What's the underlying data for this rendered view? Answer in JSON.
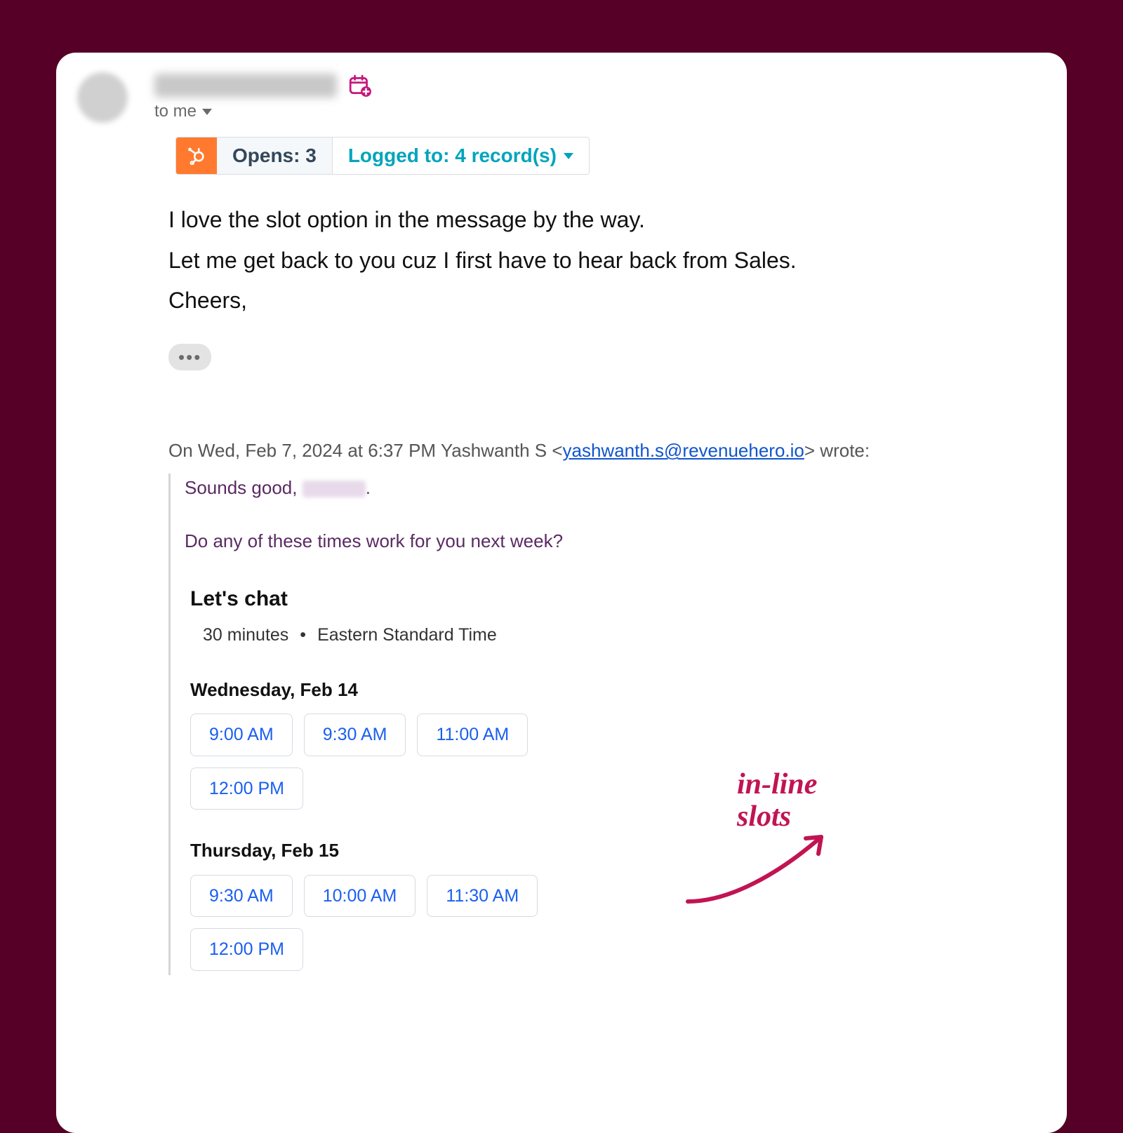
{
  "header": {
    "to_label": "to me"
  },
  "hubspot": {
    "opens_label": "Opens: 3",
    "logged_label": "Logged to: 4 record(s)"
  },
  "message": {
    "line1": "I love the slot option in the message by the way.",
    "line2": "Let me get back to you cuz I first have to hear back from Sales.",
    "line3": "Cheers,"
  },
  "quote_intro": {
    "prefix": "On Wed, Feb 7, 2024 at 6:37 PM Yashwanth S <",
    "email": "yashwanth.s@revenuehero.io",
    "suffix": "> wrote:"
  },
  "quoted": {
    "line1a": "Sounds good, ",
    "line1b": ".",
    "line2": "Do any of these times work for you next week?"
  },
  "scheduler": {
    "title": "Let's chat",
    "duration": "30 minutes",
    "tz": "Eastern Standard Time",
    "days": [
      {
        "label": "Wednesday, Feb 14",
        "slots": [
          "9:00 AM",
          "9:30 AM",
          "11:00 AM",
          "12:00 PM"
        ]
      },
      {
        "label": "Thursday, Feb 15",
        "slots": [
          "9:30 AM",
          "10:00 AM",
          "11:30 AM",
          "12:00 PM"
        ]
      }
    ]
  },
  "annotation": {
    "line1": "in-line",
    "line2": "slots"
  }
}
